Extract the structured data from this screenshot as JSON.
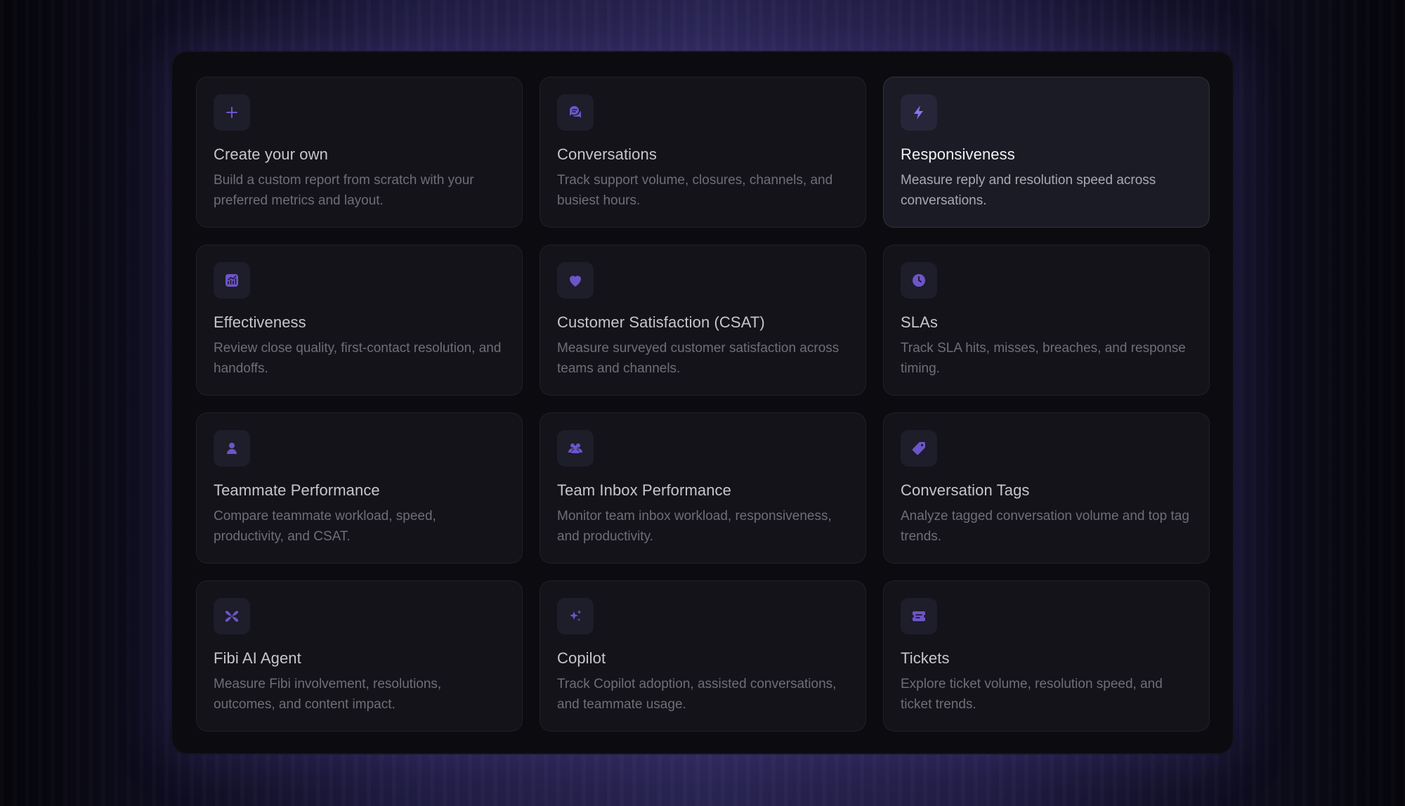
{
  "accent_color": "#6d55c9",
  "accent_color_active": "#8b74ee",
  "cards": [
    {
      "title": "Create your own",
      "desc": "Build a custom report from scratch with your preferred metrics and layout.",
      "icon": "plus-icon"
    },
    {
      "title": "Conversations",
      "desc": "Track support volume, closures, channels, and busiest hours.",
      "icon": "chat-bubbles-icon"
    },
    {
      "title": "Responsiveness",
      "desc": "Measure reply and resolution speed across conversations.",
      "icon": "lightning-icon",
      "active": true
    },
    {
      "title": "Effectiveness",
      "desc": "Review close quality, first-contact resolution, and handoffs.",
      "icon": "chart-icon"
    },
    {
      "title": "Customer Satisfaction (CSAT)",
      "desc": "Measure surveyed customer satisfaction across teams and channels.",
      "icon": "heart-icon"
    },
    {
      "title": "SLAs",
      "desc": "Track SLA hits, misses, breaches, and response timing.",
      "icon": "clock-icon"
    },
    {
      "title": "Teammate Performance",
      "desc": "Compare teammate workload, speed, productivity, and CSAT.",
      "icon": "person-icon"
    },
    {
      "title": "Team Inbox Performance",
      "desc": "Monitor team inbox workload, responsiveness, and productivity.",
      "icon": "team-icon"
    },
    {
      "title": "Conversation Tags",
      "desc": "Analyze tagged conversation volume and top tag trends.",
      "icon": "tag-icon"
    },
    {
      "title": "Fibi AI Agent",
      "desc": "Measure Fibi involvement, resolutions, outcomes, and content impact.",
      "icon": "fibi-logo-icon"
    },
    {
      "title": "Copilot",
      "desc": "Track Copilot adoption, assisted conversations, and teammate usage.",
      "icon": "sparkles-icon"
    },
    {
      "title": "Tickets",
      "desc": "Explore ticket volume, resolution speed, and ticket trends.",
      "icon": "ticket-icon"
    }
  ]
}
